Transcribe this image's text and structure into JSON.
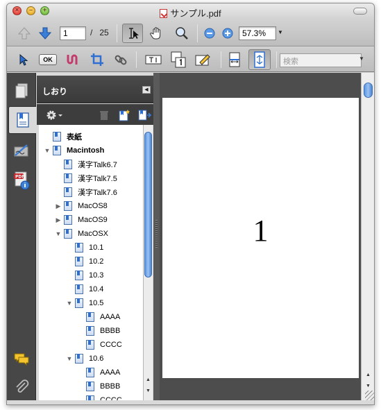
{
  "window": {
    "title": "サンプル.pdf"
  },
  "toolbar": {
    "page_current": "1",
    "page_separator": "/",
    "page_total": "25",
    "zoom": "57.3%",
    "search_placeholder": "検索",
    "ok_label": "OK"
  },
  "sidebar": {
    "panel_title": "しおり"
  },
  "bookmarks": [
    {
      "label": "表紙",
      "bold": true,
      "level": 0,
      "toggle": ""
    },
    {
      "label": "Macintosh",
      "bold": true,
      "level": 0,
      "toggle": "▼"
    },
    {
      "label": "漢字Talk6.7",
      "bold": false,
      "level": 1,
      "toggle": ""
    },
    {
      "label": "漢字Talk7.5",
      "bold": false,
      "level": 1,
      "toggle": ""
    },
    {
      "label": "漢字Talk7.6",
      "bold": false,
      "level": 1,
      "toggle": ""
    },
    {
      "label": "MacOS8",
      "bold": false,
      "level": 1,
      "toggle": "▶"
    },
    {
      "label": "MacOS9",
      "bold": false,
      "level": 1,
      "toggle": "▶"
    },
    {
      "label": "MacOSX",
      "bold": false,
      "level": 1,
      "toggle": "▼"
    },
    {
      "label": "10.1",
      "bold": false,
      "level": 2,
      "toggle": ""
    },
    {
      "label": "10.2",
      "bold": false,
      "level": 2,
      "toggle": ""
    },
    {
      "label": "10.3",
      "bold": false,
      "level": 2,
      "toggle": ""
    },
    {
      "label": "10.4",
      "bold": false,
      "level": 2,
      "toggle": ""
    },
    {
      "label": "10.5",
      "bold": false,
      "level": 2,
      "toggle": "▼"
    },
    {
      "label": "AAAA",
      "bold": false,
      "level": 3,
      "toggle": ""
    },
    {
      "label": "BBBB",
      "bold": false,
      "level": 3,
      "toggle": ""
    },
    {
      "label": "CCCC",
      "bold": false,
      "level": 3,
      "toggle": ""
    },
    {
      "label": "10.6",
      "bold": false,
      "level": 2,
      "toggle": "▼"
    },
    {
      "label": "AAAA",
      "bold": false,
      "level": 3,
      "toggle": ""
    },
    {
      "label": "BBBB",
      "bold": false,
      "level": 3,
      "toggle": ""
    },
    {
      "label": "CCCC",
      "bold": false,
      "level": 3,
      "toggle": ""
    }
  ],
  "document": {
    "page_label": "1"
  }
}
